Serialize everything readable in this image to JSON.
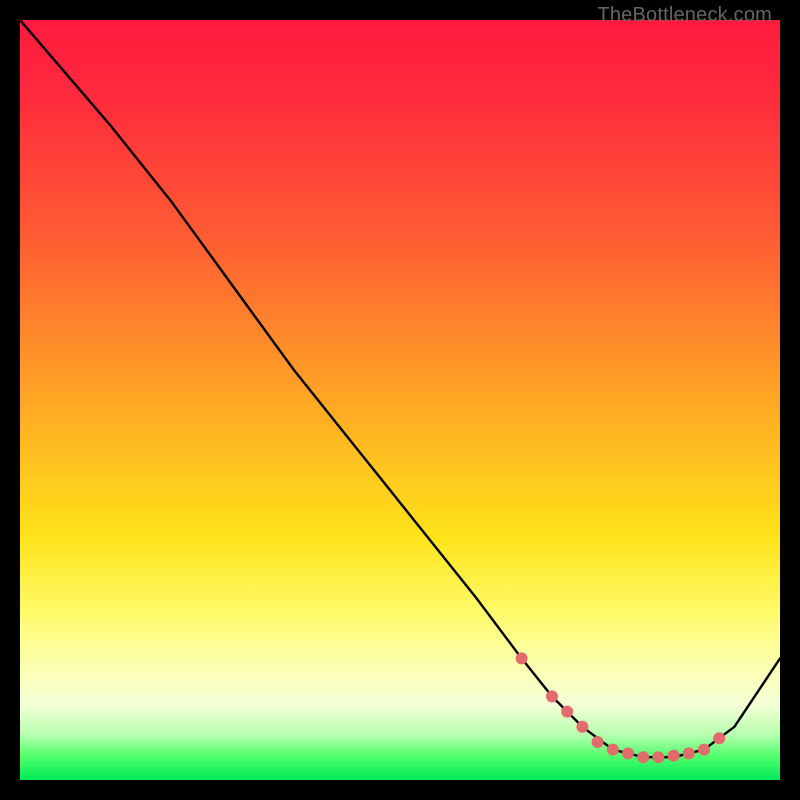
{
  "watermark": "TheBottleneck.com",
  "chart_data": {
    "type": "line",
    "title": "",
    "xlabel": "",
    "ylabel": "",
    "xlim": [
      0,
      100
    ],
    "ylim": [
      0,
      100
    ],
    "grid": false,
    "legend": false,
    "series": [
      {
        "name": "curve",
        "color": "#000000",
        "x": [
          0,
          6,
          12,
          20,
          28,
          36,
          44,
          52,
          60,
          66,
          70,
          74,
          78,
          82,
          86,
          90,
          94,
          100
        ],
        "y": [
          100,
          93,
          86,
          76,
          65,
          54,
          44,
          34,
          24,
          16,
          11,
          7,
          4,
          3,
          3,
          4,
          7,
          16
        ]
      }
    ],
    "markers": {
      "name": "dots",
      "color": "#e26b6b",
      "radius_px": 6,
      "x": [
        66,
        70,
        72,
        74,
        76,
        78,
        80,
        82,
        84,
        86,
        88,
        90,
        92
      ],
      "y": [
        16,
        11,
        9,
        7,
        5,
        4,
        3.5,
        3,
        3,
        3.2,
        3.5,
        4,
        5.5
      ]
    }
  }
}
